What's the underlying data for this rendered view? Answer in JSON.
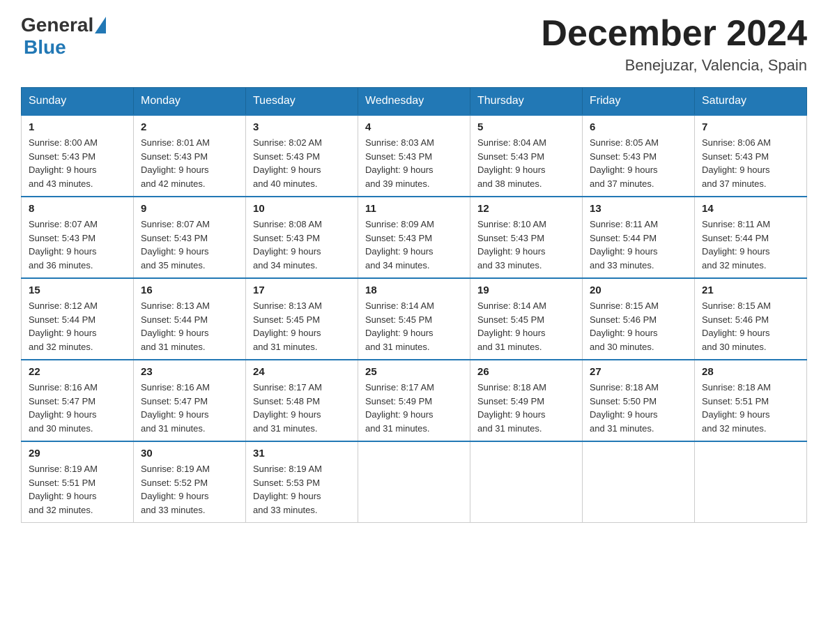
{
  "header": {
    "logo_general": "General",
    "logo_blue": "Blue",
    "month_title": "December 2024",
    "location": "Benejuzar, Valencia, Spain"
  },
  "weekdays": [
    "Sunday",
    "Monday",
    "Tuesday",
    "Wednesday",
    "Thursday",
    "Friday",
    "Saturday"
  ],
  "weeks": [
    [
      {
        "day": "1",
        "sunrise": "8:00 AM",
        "sunset": "5:43 PM",
        "daylight": "9 hours and 43 minutes."
      },
      {
        "day": "2",
        "sunrise": "8:01 AM",
        "sunset": "5:43 PM",
        "daylight": "9 hours and 42 minutes."
      },
      {
        "day": "3",
        "sunrise": "8:02 AM",
        "sunset": "5:43 PM",
        "daylight": "9 hours and 40 minutes."
      },
      {
        "day": "4",
        "sunrise": "8:03 AM",
        "sunset": "5:43 PM",
        "daylight": "9 hours and 39 minutes."
      },
      {
        "day": "5",
        "sunrise": "8:04 AM",
        "sunset": "5:43 PM",
        "daylight": "9 hours and 38 minutes."
      },
      {
        "day": "6",
        "sunrise": "8:05 AM",
        "sunset": "5:43 PM",
        "daylight": "9 hours and 37 minutes."
      },
      {
        "day": "7",
        "sunrise": "8:06 AM",
        "sunset": "5:43 PM",
        "daylight": "9 hours and 37 minutes."
      }
    ],
    [
      {
        "day": "8",
        "sunrise": "8:07 AM",
        "sunset": "5:43 PM",
        "daylight": "9 hours and 36 minutes."
      },
      {
        "day": "9",
        "sunrise": "8:07 AM",
        "sunset": "5:43 PM",
        "daylight": "9 hours and 35 minutes."
      },
      {
        "day": "10",
        "sunrise": "8:08 AM",
        "sunset": "5:43 PM",
        "daylight": "9 hours and 34 minutes."
      },
      {
        "day": "11",
        "sunrise": "8:09 AM",
        "sunset": "5:43 PM",
        "daylight": "9 hours and 34 minutes."
      },
      {
        "day": "12",
        "sunrise": "8:10 AM",
        "sunset": "5:43 PM",
        "daylight": "9 hours and 33 minutes."
      },
      {
        "day": "13",
        "sunrise": "8:11 AM",
        "sunset": "5:44 PM",
        "daylight": "9 hours and 33 minutes."
      },
      {
        "day": "14",
        "sunrise": "8:11 AM",
        "sunset": "5:44 PM",
        "daylight": "9 hours and 32 minutes."
      }
    ],
    [
      {
        "day": "15",
        "sunrise": "8:12 AM",
        "sunset": "5:44 PM",
        "daylight": "9 hours and 32 minutes."
      },
      {
        "day": "16",
        "sunrise": "8:13 AM",
        "sunset": "5:44 PM",
        "daylight": "9 hours and 31 minutes."
      },
      {
        "day": "17",
        "sunrise": "8:13 AM",
        "sunset": "5:45 PM",
        "daylight": "9 hours and 31 minutes."
      },
      {
        "day": "18",
        "sunrise": "8:14 AM",
        "sunset": "5:45 PM",
        "daylight": "9 hours and 31 minutes."
      },
      {
        "day": "19",
        "sunrise": "8:14 AM",
        "sunset": "5:45 PM",
        "daylight": "9 hours and 31 minutes."
      },
      {
        "day": "20",
        "sunrise": "8:15 AM",
        "sunset": "5:46 PM",
        "daylight": "9 hours and 30 minutes."
      },
      {
        "day": "21",
        "sunrise": "8:15 AM",
        "sunset": "5:46 PM",
        "daylight": "9 hours and 30 minutes."
      }
    ],
    [
      {
        "day": "22",
        "sunrise": "8:16 AM",
        "sunset": "5:47 PM",
        "daylight": "9 hours and 30 minutes."
      },
      {
        "day": "23",
        "sunrise": "8:16 AM",
        "sunset": "5:47 PM",
        "daylight": "9 hours and 31 minutes."
      },
      {
        "day": "24",
        "sunrise": "8:17 AM",
        "sunset": "5:48 PM",
        "daylight": "9 hours and 31 minutes."
      },
      {
        "day": "25",
        "sunrise": "8:17 AM",
        "sunset": "5:49 PM",
        "daylight": "9 hours and 31 minutes."
      },
      {
        "day": "26",
        "sunrise": "8:18 AM",
        "sunset": "5:49 PM",
        "daylight": "9 hours and 31 minutes."
      },
      {
        "day": "27",
        "sunrise": "8:18 AM",
        "sunset": "5:50 PM",
        "daylight": "9 hours and 31 minutes."
      },
      {
        "day": "28",
        "sunrise": "8:18 AM",
        "sunset": "5:51 PM",
        "daylight": "9 hours and 32 minutes."
      }
    ],
    [
      {
        "day": "29",
        "sunrise": "8:19 AM",
        "sunset": "5:51 PM",
        "daylight": "9 hours and 32 minutes."
      },
      {
        "day": "30",
        "sunrise": "8:19 AM",
        "sunset": "5:52 PM",
        "daylight": "9 hours and 33 minutes."
      },
      {
        "day": "31",
        "sunrise": "8:19 AM",
        "sunset": "5:53 PM",
        "daylight": "9 hours and 33 minutes."
      },
      null,
      null,
      null,
      null
    ]
  ],
  "labels": {
    "sunrise": "Sunrise:",
    "sunset": "Sunset:",
    "daylight": "Daylight:"
  }
}
